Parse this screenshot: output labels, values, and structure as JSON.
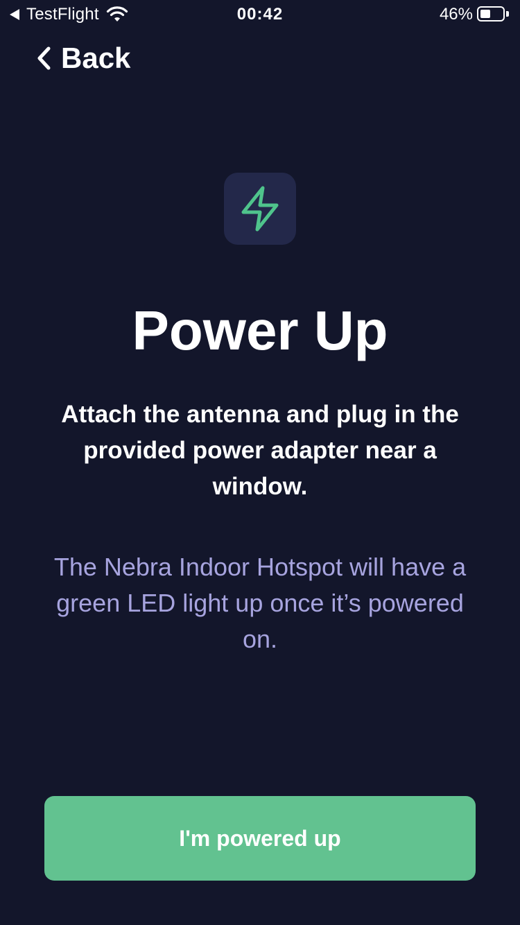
{
  "status_bar": {
    "back_app": "TestFlight",
    "time": "00:42",
    "battery_percent": "46%",
    "battery_level": 0.46
  },
  "nav": {
    "back_label": "Back"
  },
  "hero": {
    "icon": "lightning-icon",
    "icon_color": "#4fc48c",
    "icon_bg": "#23284a"
  },
  "content": {
    "title": "Power Up",
    "subtitle": "Attach the antenna and plug in the provided power adapter near a window.",
    "body": "The Nebra Indoor Hotspot will have a green LED light up once it’s powered on."
  },
  "actions": {
    "primary_label": "I'm powered up",
    "primary_color": "#62c290"
  },
  "colors": {
    "background": "#13162b",
    "body_text": "#a7a4df"
  }
}
